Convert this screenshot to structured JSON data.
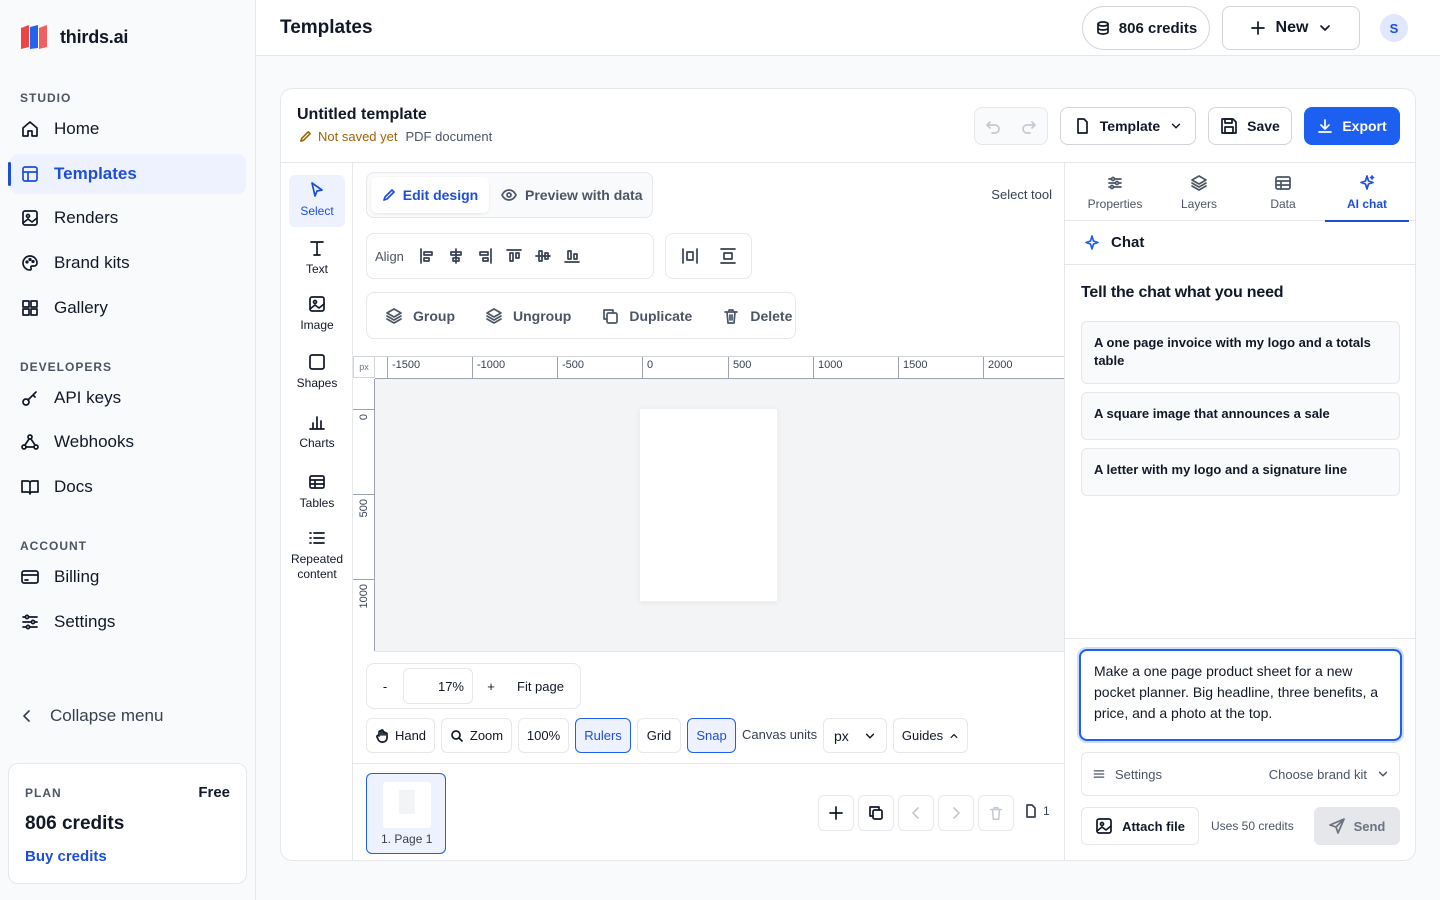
{
  "app": {
    "brand": "thirds.ai",
    "page_title": "Templates"
  },
  "sidebar": {
    "studio_label": "STUDIO",
    "studio_items": [
      {
        "label": "Home",
        "icon": "home-icon"
      },
      {
        "label": "Templates",
        "icon": "template-icon",
        "active": true
      },
      {
        "label": "Renders",
        "icon": "image-icon"
      },
      {
        "label": "Brand kits",
        "icon": "palette-icon"
      },
      {
        "label": "Gallery",
        "icon": "grid-icon"
      }
    ],
    "developers_label": "DEVELOPERS",
    "developer_items": [
      {
        "label": "API keys",
        "icon": "key-icon"
      },
      {
        "label": "Webhooks",
        "icon": "webhook-icon"
      },
      {
        "label": "Docs",
        "icon": "book-icon"
      }
    ],
    "account_label": "ACCOUNT",
    "account_items": [
      {
        "label": "Billing",
        "icon": "credit-card-icon"
      },
      {
        "label": "Settings",
        "icon": "sliders-icon"
      }
    ],
    "collapse_label": "Collapse menu",
    "plan": {
      "label": "PLAN",
      "tier": "Free",
      "credits": "806 credits",
      "buy": "Buy credits"
    }
  },
  "header": {
    "credits": "806 credits",
    "new_label": "New",
    "avatar_initial": "S"
  },
  "editor": {
    "template_name": "Untitled template",
    "save_status": "Not saved yet",
    "doc_type": "PDF document",
    "template_dropdown": "Template",
    "save_label": "Save",
    "export_label": "Export"
  },
  "tools": [
    {
      "label": "Select",
      "icon": "cursor-icon",
      "active": true
    },
    {
      "label": "Text",
      "icon": "text-icon"
    },
    {
      "label": "Image",
      "icon": "image-icon"
    },
    {
      "label": "Shapes",
      "icon": "square-icon"
    },
    {
      "label": "Charts",
      "icon": "bar-chart-icon"
    },
    {
      "label": "Tables",
      "icon": "table-icon"
    },
    {
      "label": "Repeated content",
      "icon": "list-icon"
    }
  ],
  "canvas": {
    "edit_design": "Edit design",
    "preview_with_data": "Preview with data",
    "select_tool_label": "Select tool",
    "align_label": "Align",
    "object_actions": [
      "Group",
      "Ungroup",
      "Duplicate",
      "Delete"
    ],
    "ruler_unit": "px",
    "ruler_h_labels": [
      "-1500",
      "-1000",
      "-500",
      "0",
      "500",
      "1000",
      "1500",
      "2000"
    ],
    "ruler_v_labels": [
      "0",
      "500",
      "1000"
    ],
    "zoom_minus": "-",
    "zoom_value": "17%",
    "zoom_plus": "+",
    "fit_page": "Fit page",
    "view_buttons": [
      "Hand",
      "Zoom",
      "100%",
      "Rulers",
      "Grid",
      "Snap"
    ],
    "active_view_buttons": [
      "Rulers",
      "Snap"
    ],
    "canvas_units_label": "Canvas units",
    "canvas_units_value": "px",
    "guides_label": "Guides",
    "page_thumb_label": "1. Page 1",
    "page_count": "1"
  },
  "right_panel": {
    "tabs": [
      "Properties",
      "Layers",
      "Data",
      "AI chat"
    ],
    "active_tab": "AI chat",
    "chat_title": "Chat",
    "prompt_heading": "Tell the chat what you need",
    "suggestions": [
      "A one page invoice with my logo and a totals table",
      "A square image that announces a sale",
      "A letter with my logo and a signature line"
    ],
    "input_text": "Make a one page product sheet for a new pocket planner. Big headline, three benefits, a price, and a photo at the top.",
    "settings_label": "Settings",
    "brand_kit_label": "Choose brand kit",
    "attach_label": "Attach file",
    "uses_label": "Uses 50 credits",
    "send_label": "Send"
  },
  "colors": {
    "accent": "#1d5ff0",
    "accent_dark": "#1d4ed8",
    "active_bg": "#eef2fe",
    "warning": "#a16207"
  }
}
